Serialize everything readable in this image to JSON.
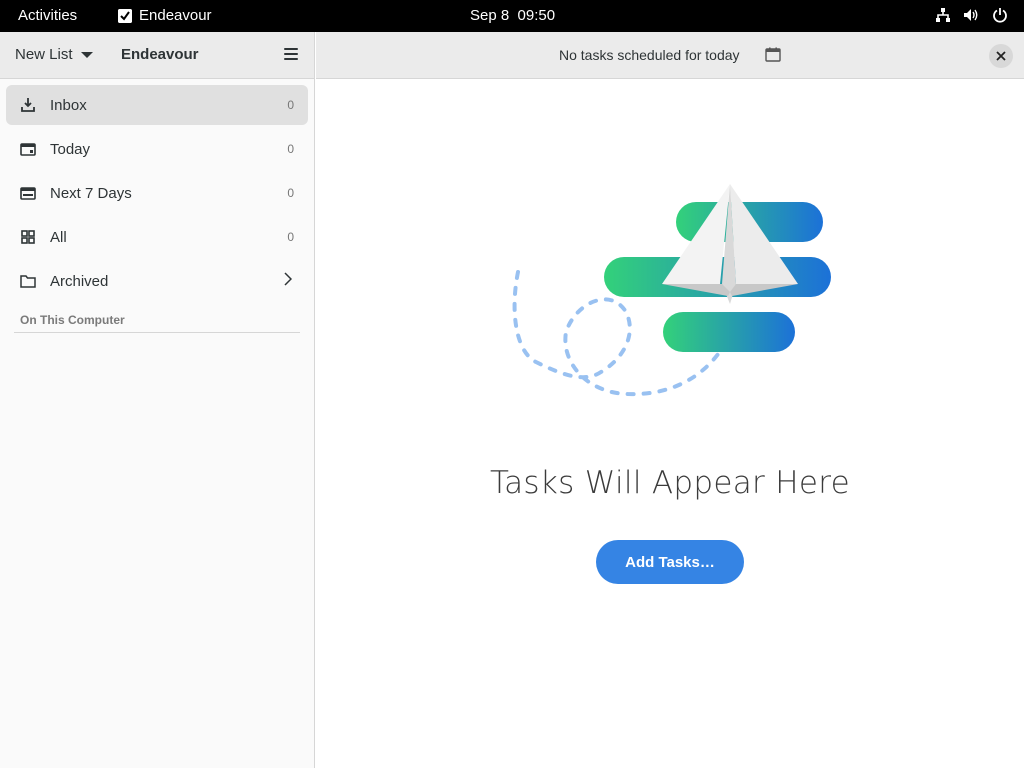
{
  "topbar": {
    "activities": "Activities",
    "app_name": "Endeavour",
    "date": "Sep 8",
    "time": "09:50",
    "tray_icons": [
      "network-icon",
      "volume-icon",
      "power-icon"
    ]
  },
  "sidebar": {
    "new_list_label": "New List",
    "title": "Endeavour",
    "items": [
      {
        "label": "Inbox",
        "count": "0",
        "icon": "inbox-download-icon",
        "selected": true
      },
      {
        "label": "Today",
        "count": "0",
        "icon": "calendar-icon"
      },
      {
        "label": "Next 7 Days",
        "count": "0",
        "icon": "calendar-week-icon"
      },
      {
        "label": "All",
        "count": "0",
        "icon": "grid-icon"
      },
      {
        "label": "Archived",
        "icon": "folder-icon",
        "has_chevron": true
      }
    ],
    "section_label": "On This Computer"
  },
  "main": {
    "header_text": "No tasks scheduled for today",
    "empty_title": "Tasks Will Appear Here",
    "add_button_label": "Add Tasks…"
  },
  "colors": {
    "accent": "#3584e4",
    "illustration_gradient_start": "#33d17a",
    "illustration_gradient_end": "#1c71d8",
    "dashes": "#99c1f1"
  }
}
